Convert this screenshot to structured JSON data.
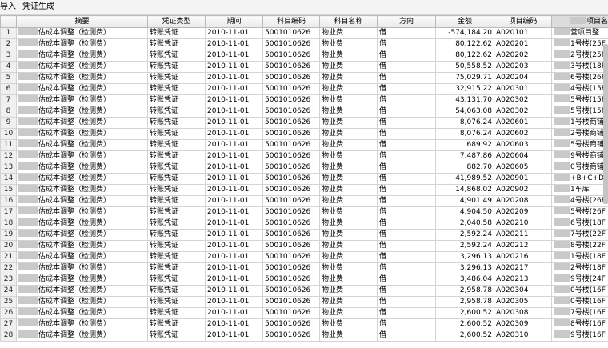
{
  "menu": [
    "导入",
    "凭证生成"
  ],
  "columns": [
    "",
    "摘要",
    "凭证类型",
    "期间",
    "科目编码",
    "科目名称",
    "方向",
    "金额",
    "项目编码",
    "项目名称"
  ],
  "rows": [
    {
      "n": "1",
      "summary": "估成本调整（检测费）",
      "vtype": "转账凭证",
      "period": "2010-11-01",
      "code": "5001010626",
      "name": "物业费",
      "dir": "借",
      "amount": "-574,184.20",
      "pcode": "A020101",
      "pname": "营项目整"
    },
    {
      "n": "2",
      "summary": "估成本调整（检测费）",
      "vtype": "转账凭证",
      "period": "2010-11-01",
      "code": "5001010626",
      "name": "物业费",
      "dir": "借",
      "amount": "80,122.62",
      "pcode": "A020201",
      "pname": "1号楼(25F"
    },
    {
      "n": "3",
      "summary": "估成本调整（检测费）",
      "vtype": "转账凭证",
      "period": "2010-11-01",
      "code": "5001010626",
      "name": "物业费",
      "dir": "借",
      "amount": "80,122.62",
      "pcode": "A020202",
      "pname": "2号楼(25F"
    },
    {
      "n": "4",
      "summary": "估成本调整（检测费）",
      "vtype": "转账凭证",
      "period": "2010-11-01",
      "code": "5001010626",
      "name": "物业费",
      "dir": "借",
      "amount": "50,558.52",
      "pcode": "A020203",
      "pname": "3号楼(18F"
    },
    {
      "n": "5",
      "summary": "估成本调整（检测费）",
      "vtype": "转账凭证",
      "period": "2010-11-01",
      "code": "5001010626",
      "name": "物业费",
      "dir": "借",
      "amount": "75,029.71",
      "pcode": "A020204",
      "pname": "6号楼(26F"
    },
    {
      "n": "6",
      "summary": "估成本调整（检测费）",
      "vtype": "转账凭证",
      "period": "2010-11-01",
      "code": "5001010626",
      "name": "物业费",
      "dir": "借",
      "amount": "32,915.22",
      "pcode": "A020301",
      "pname": "4号楼(15F"
    },
    {
      "n": "7",
      "summary": "估成本调整（检测费）",
      "vtype": "转账凭证",
      "period": "2010-11-01",
      "code": "5001010626",
      "name": "物业费",
      "dir": "借",
      "amount": "43,131.70",
      "pcode": "A020302",
      "pname": "5号楼(15F"
    },
    {
      "n": "8",
      "summary": "估成本调整（检测费）",
      "vtype": "转账凭证",
      "period": "2010-11-01",
      "code": "5001010626",
      "name": "物业费",
      "dir": "借",
      "amount": "54,063.08",
      "pcode": "A020302",
      "pname": "5号楼(15F"
    },
    {
      "n": "9",
      "summary": "估成本调整（检测费）",
      "vtype": "转账凭证",
      "period": "2010-11-01",
      "code": "5001010626",
      "name": "物业费",
      "dir": "借",
      "amount": "8,076.24",
      "pcode": "A020601",
      "pname": "1号楼商铺"
    },
    {
      "n": "10",
      "summary": "估成本调整（检测费）",
      "vtype": "转账凭证",
      "period": "2010-11-01",
      "code": "5001010626",
      "name": "物业费",
      "dir": "借",
      "amount": "8,076.24",
      "pcode": "A020602",
      "pname": "2号楼商铺"
    },
    {
      "n": "11",
      "summary": "估成本调整（检测费）",
      "vtype": "转账凭证",
      "period": "2010-11-01",
      "code": "5001010626",
      "name": "物业费",
      "dir": "借",
      "amount": "689.92",
      "pcode": "A020603",
      "pname": "5号楼商铺"
    },
    {
      "n": "12",
      "summary": "估成本调整（检测费）",
      "vtype": "转账凭证",
      "period": "2010-11-01",
      "code": "5001010626",
      "name": "物业费",
      "dir": "借",
      "amount": "7,487.86",
      "pcode": "A020604",
      "pname": "9号楼商铺"
    },
    {
      "n": "13",
      "summary": "估成本调整（检测费）",
      "vtype": "转账凭证",
      "period": "2010-11-01",
      "code": "5001010626",
      "name": "物业费",
      "dir": "借",
      "amount": "882.70",
      "pcode": "A020605",
      "pname": "0号楼商铺"
    },
    {
      "n": "14",
      "summary": "估成本调整（检测费）",
      "vtype": "转账凭证",
      "period": "2010-11-01",
      "code": "5001010626",
      "name": "物业费",
      "dir": "借",
      "amount": "41,989.52",
      "pcode": "A020901",
      "pname": "+B+C+D..."
    },
    {
      "n": "15",
      "summary": "估成本调整（检测费）",
      "vtype": "转账凭证",
      "period": "2010-11-01",
      "code": "5001010626",
      "name": "物业费",
      "dir": "借",
      "amount": "14,868.02",
      "pcode": "A020902",
      "pname": "1车库"
    },
    {
      "n": "16",
      "summary": "估成本调整（检测费）",
      "vtype": "转账凭证",
      "period": "2010-11-01",
      "code": "5001010626",
      "name": "物业费",
      "dir": "借",
      "amount": "4,901.49",
      "pcode": "A020208",
      "pname": "4号楼(26F"
    },
    {
      "n": "17",
      "summary": "估成本调整（检测费）",
      "vtype": "转账凭证",
      "period": "2010-11-01",
      "code": "5001010626",
      "name": "物业费",
      "dir": "借",
      "amount": "4,904.50",
      "pcode": "A020209",
      "pname": "5号楼(26F"
    },
    {
      "n": "18",
      "summary": "估成本调整（检测费）",
      "vtype": "转账凭证",
      "period": "2010-11-01",
      "code": "5001010626",
      "name": "物业费",
      "dir": "借",
      "amount": "2,040.58",
      "pcode": "A020210",
      "pname": "6号楼(18F"
    },
    {
      "n": "19",
      "summary": "估成本调整（检测费）",
      "vtype": "转账凭证",
      "period": "2010-11-01",
      "code": "5001010626",
      "name": "物业费",
      "dir": "借",
      "amount": "2,592.24",
      "pcode": "A020211",
      "pname": "7号楼(22F"
    },
    {
      "n": "20",
      "summary": "估成本调整（检测费）",
      "vtype": "转账凭证",
      "period": "2010-11-01",
      "code": "5001010626",
      "name": "物业费",
      "dir": "借",
      "amount": "2,592.24",
      "pcode": "A020212",
      "pname": "8号楼(22F"
    },
    {
      "n": "21",
      "summary": "估成本调整（检测费）",
      "vtype": "转账凭证",
      "period": "2010-11-01",
      "code": "5001010626",
      "name": "物业费",
      "dir": "借",
      "amount": "3,296.13",
      "pcode": "A020216",
      "pname": "1号楼(18F"
    },
    {
      "n": "22",
      "summary": "估成本调整（检测费）",
      "vtype": "转账凭证",
      "period": "2010-11-01",
      "code": "5001010626",
      "name": "物业费",
      "dir": "借",
      "amount": "3,296.13",
      "pcode": "A020217",
      "pname": "2号楼(18F"
    },
    {
      "n": "23",
      "summary": "估成本调整（检测费）",
      "vtype": "转账凭证",
      "period": "2010-11-01",
      "code": "5001010626",
      "name": "物业费",
      "dir": "借",
      "amount": "3,486.04",
      "pcode": "A020213",
      "pname": "9号楼(24F"
    },
    {
      "n": "24",
      "summary": "估成本调整（检测费）",
      "vtype": "转账凭证",
      "period": "2010-11-01",
      "code": "5001010626",
      "name": "物业费",
      "dir": "借",
      "amount": "2,958.78",
      "pcode": "A020304",
      "pname": "0号楼(16F"
    },
    {
      "n": "25",
      "summary": "估成本调整（检测费）",
      "vtype": "转账凭证",
      "period": "2010-11-01",
      "code": "5001010626",
      "name": "物业费",
      "dir": "借",
      "amount": "2,958.78",
      "pcode": "A020305",
      "pname": "0号楼(16F"
    },
    {
      "n": "26",
      "summary": "估成本调整（检测费）",
      "vtype": "转账凭证",
      "period": "2010-11-01",
      "code": "5001010626",
      "name": "物业费",
      "dir": "借",
      "amount": "2,600.52",
      "pcode": "A020308",
      "pname": "7号楼(16F"
    },
    {
      "n": "27",
      "summary": "估成本调整（检测费）",
      "vtype": "转账凭证",
      "period": "2010-11-01",
      "code": "5001010626",
      "name": "物业费",
      "dir": "借",
      "amount": "2,600.52",
      "pcode": "A020309",
      "pname": "8号楼(16F"
    },
    {
      "n": "28",
      "summary": "估成本调整（检测费）",
      "vtype": "转账凭证",
      "period": "2010-11-01",
      "code": "5001010626",
      "name": "物业费",
      "dir": "借",
      "amount": "2,600.52",
      "pcode": "A020310",
      "pname": "9号楼(16F"
    }
  ]
}
